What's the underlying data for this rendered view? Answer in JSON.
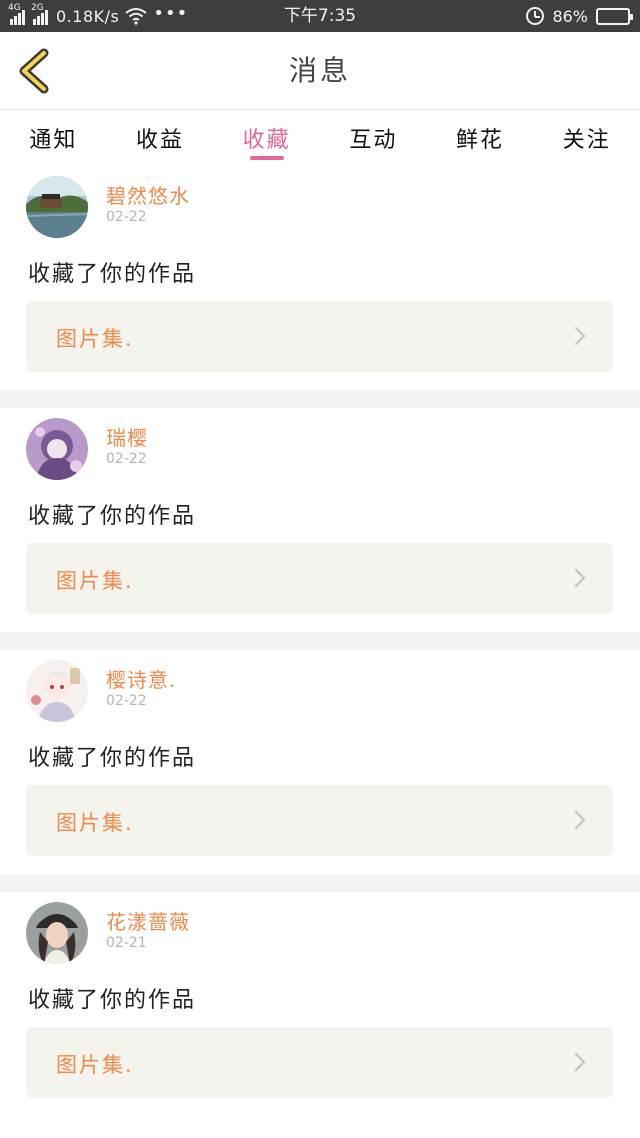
{
  "status_bar": {
    "net1": "4G",
    "net2": "2G",
    "speed": "0.18K/s",
    "dots": "•••",
    "time": "下午7:35",
    "battery": "86%",
    "battery_level": 0.86
  },
  "header": {
    "title": "消息"
  },
  "tabs": [
    {
      "label": "通知"
    },
    {
      "label": "收益"
    },
    {
      "label": "收藏"
    },
    {
      "label": "互动"
    },
    {
      "label": "鲜花"
    },
    {
      "label": "关注"
    }
  ],
  "active_tab": "收藏",
  "feed": [
    {
      "user": "碧然悠水",
      "date": "02-22",
      "action": "收藏了你的作品",
      "work": "图片集."
    },
    {
      "user": "瑞樱",
      "date": "02-22",
      "action": "收藏了你的作品",
      "work": "图片集."
    },
    {
      "user": "樱诗意.",
      "date": "02-22",
      "action": "收藏了你的作品",
      "work": "图片集."
    },
    {
      "user": "花漾蔷薇",
      "date": "02-21",
      "action": "收藏了你的作品",
      "work": "图片集."
    }
  ],
  "colors": {
    "accent": "#e8679b",
    "username": "#f08a4b",
    "status_bar": "#3e3e3e",
    "work_box": "#f4f3ee"
  },
  "icons": {
    "back": "back-chevron-icon",
    "wifi": "wifi-icon",
    "alarm": "alarm-clock-icon",
    "battery": "battery-icon",
    "chevron": "chevron-right-icon"
  }
}
